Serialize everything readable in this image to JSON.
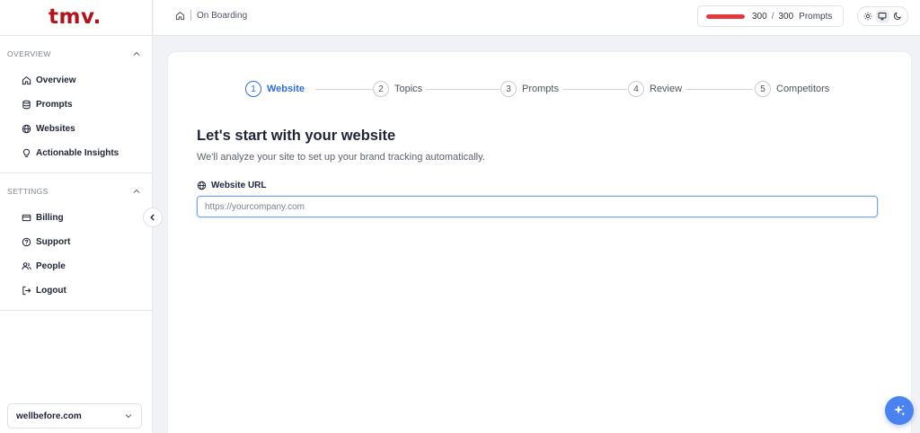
{
  "sidebar": {
    "logo": "tmv.",
    "sections": [
      {
        "title": "OVERVIEW",
        "items": [
          {
            "label": "Overview",
            "icon": "home-icon"
          },
          {
            "label": "Prompts",
            "icon": "database-icon"
          },
          {
            "label": "Websites",
            "icon": "globe-icon"
          },
          {
            "label": "Actionable Insights",
            "icon": "lightbulb-icon"
          }
        ]
      },
      {
        "title": "SETTINGS",
        "items": [
          {
            "label": "Billing",
            "icon": "credit-card-icon"
          },
          {
            "label": "Support",
            "icon": "help-circle-icon"
          },
          {
            "label": "People",
            "icon": "users-icon"
          },
          {
            "label": "Logout",
            "icon": "logout-icon"
          }
        ]
      }
    ],
    "site_selector": {
      "value": "wellbefore.com"
    }
  },
  "topbar": {
    "breadcrumb": "On Boarding",
    "prompts": {
      "used": "300",
      "total": "300",
      "label": "Prompts",
      "fraction": 1.0
    },
    "theme": {
      "active": "system"
    }
  },
  "onboarding": {
    "steps": [
      {
        "number": "1",
        "label": "Website",
        "active": true
      },
      {
        "number": "2",
        "label": "Topics",
        "active": false
      },
      {
        "number": "3",
        "label": "Prompts",
        "active": false
      },
      {
        "number": "4",
        "label": "Review",
        "active": false
      },
      {
        "number": "5",
        "label": "Competitors",
        "active": false
      }
    ],
    "title": "Let's start with your website",
    "subtitle": "We'll analyze your site to set up your brand tracking automatically.",
    "field_label": "Website URL",
    "url_placeholder": "https://yourcompany.com"
  },
  "colors": {
    "brand": "#b3121b",
    "accent": "#2f6ee0",
    "usage_bar": "#e5383b",
    "fab": "#4a83f0"
  }
}
